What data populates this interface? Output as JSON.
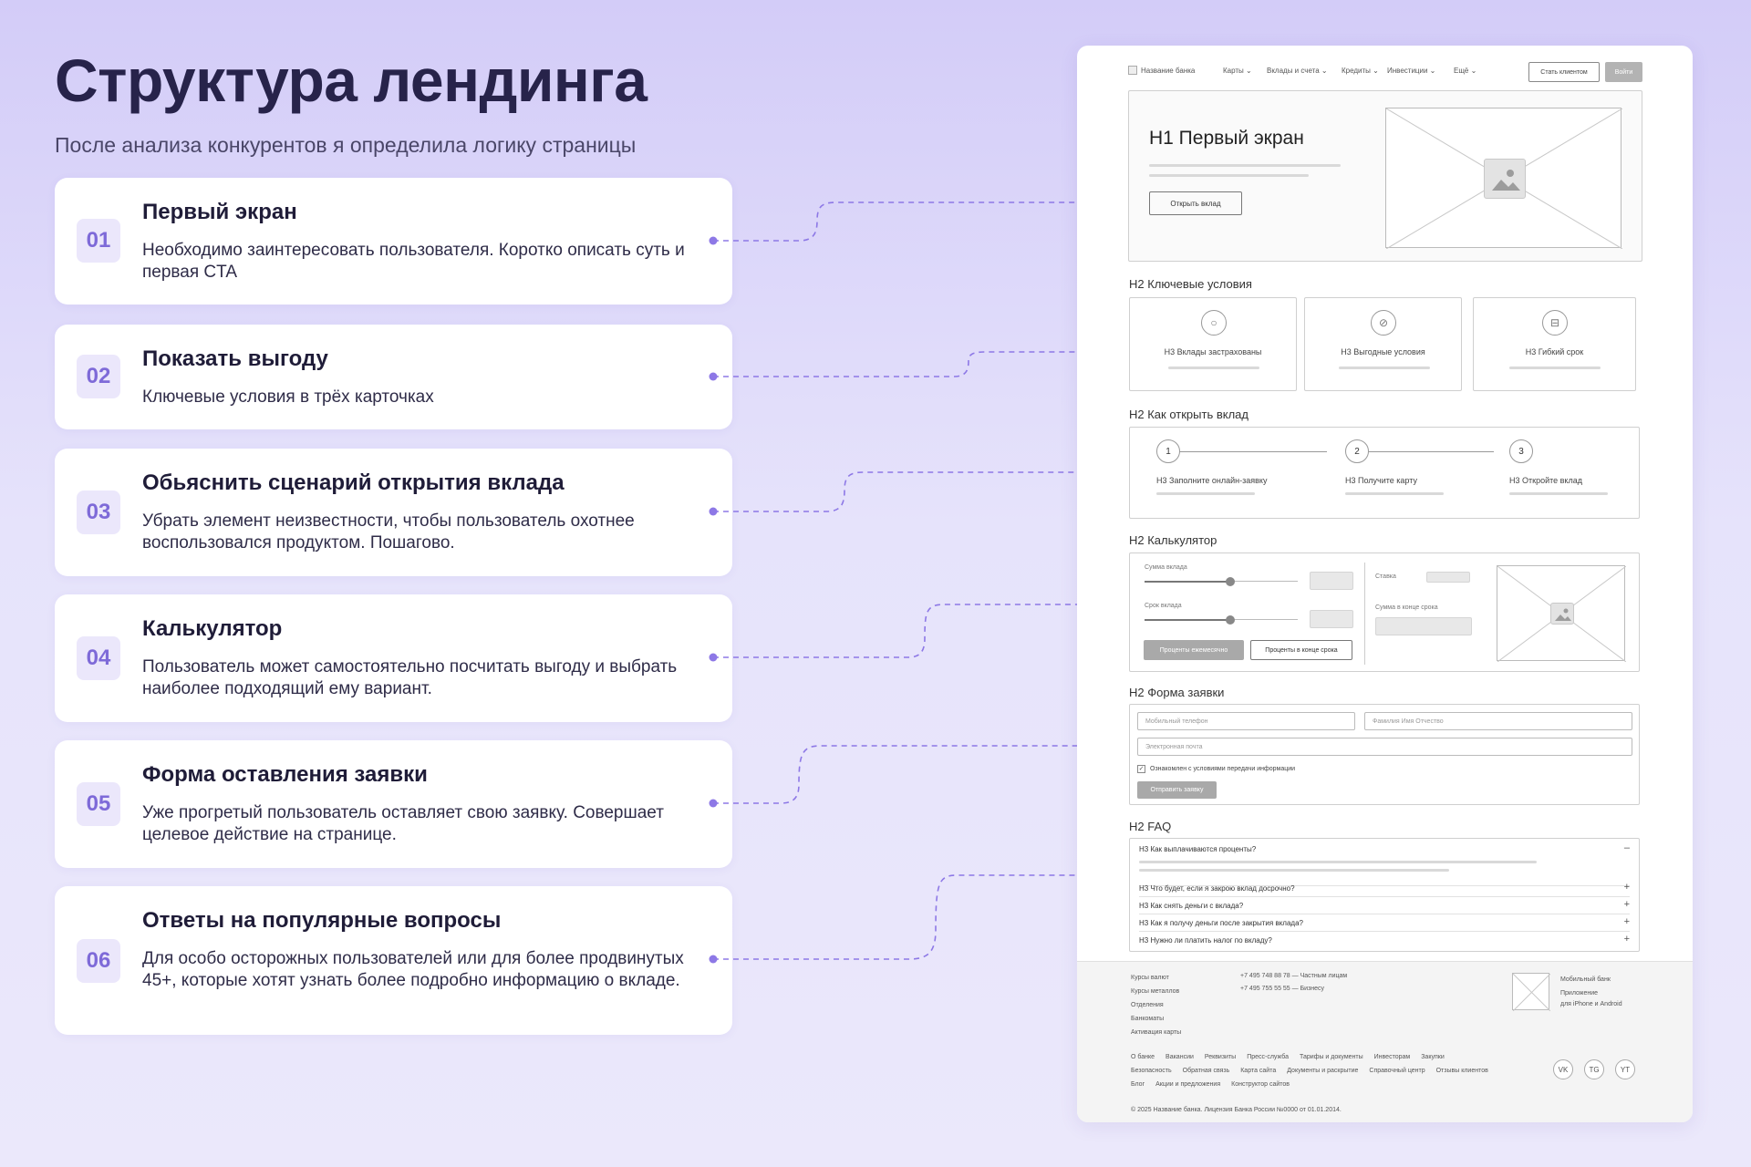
{
  "title": "Структура лендинга",
  "subtitle": "После анализа конкурентов я определила логику страницы",
  "steps": [
    {
      "num": "01",
      "title": "Первый экран",
      "desc": "Необходимо заинтересовать пользователя. Коротко описать суть и первая CTA"
    },
    {
      "num": "02",
      "title": "Показать выгоду",
      "desc": "Ключевые условия в трёх карточках"
    },
    {
      "num": "03",
      "title": "Обьяснить сценарий открытия вклада",
      "desc": "Убрать элемент неизвестности, чтобы пользователь охотнее воспользовался продуктом. Пошагово."
    },
    {
      "num": "04",
      "title": "Калькулятор",
      "desc": "Пользователь может самостоятельно посчитать выгоду и выбрать наиболее подходящий ему вариант."
    },
    {
      "num": "05",
      "title": "Форма оставления заявки",
      "desc": "Уже прогретый пользователь оставляет свою заявку. Совершает целевое действие на странице."
    },
    {
      "num": "06",
      "title": "Ответы на популярные вопросы",
      "desc": "Для особо осторожных пользователей или для более продвинутых 45+, которые хотят узнать более подробно информацию о вкладе."
    }
  ],
  "colors": {
    "accent": "#8d78e6",
    "card_num_bg": "#ebe7fb",
    "num_text": "#7e6ad8"
  },
  "wireframe": {
    "nav": {
      "logo": "Название банка",
      "menu": [
        "Карты ⌄",
        "Вклады и счета ⌄",
        "Кредиты ⌄",
        "Инвестиции ⌄",
        "Ещё ⌄"
      ],
      "client_btn": "Стать клиентом",
      "login_btn": "Войти"
    },
    "hero": {
      "h1": "H1 Первый экран",
      "cta": "Открыть вклад"
    },
    "conditions": {
      "h2": "H2 Ключевые условия",
      "cards": [
        {
          "label": "H3 Вклады застрахованы",
          "icon": "circle-icon"
        },
        {
          "label": "H3 Выгодные условия",
          "icon": "percent-icon"
        },
        {
          "label": "H3 Гибкий срок",
          "icon": "calendar-icon"
        }
      ]
    },
    "how": {
      "h2": "H2 Как открыть вклад",
      "steps": [
        {
          "n": "1",
          "label": "H3 Заполните онлайн-заявку"
        },
        {
          "n": "2",
          "label": "H3 Получите карту"
        },
        {
          "n": "3",
          "label": "H3 Откройте вклад"
        }
      ]
    },
    "calc": {
      "h2": "H2 Калькулятор",
      "sum_label": "Сумма вклада",
      "term_label": "Срок вклада",
      "rate_label": "Ставка",
      "end_label": "Сумма в конце срока",
      "btn_monthly": "Проценты ежемесячно",
      "btn_end": "Проценты в конце срока"
    },
    "form": {
      "h2": "H2 Форма заявки",
      "phone": "Мобильный телефон",
      "fio": "Фамилия Имя Отчество",
      "email": "Электронная почта",
      "consent": "Ознакомлен с условиями передачи информации",
      "submit": "Отправить заявку"
    },
    "faq": {
      "h2": "H2 FAQ",
      "open_q": "H3 Как выплачиваются проценты?",
      "open_sign": "–",
      "items": [
        "H3 Что будет, если я закрою вклад досрочно?",
        "H3 Как снять деньги с вклада?",
        "H3 Как я получу деньги после закрытия вклада?",
        "H3 Нужно ли платить налог по вкладу?"
      ],
      "plus": "+"
    },
    "footer": {
      "col1": [
        "Курсы валют",
        "Курсы металлов",
        "Отделения",
        "Банкоматы",
        "Активация карты"
      ],
      "phone1": "+7 495 748 88 78 — Частным лицам",
      "phone2": "+7 495 755 55 55 — Бизнесу",
      "app_title": "Мобильный банк",
      "app_desc1": "Приложение",
      "app_desc2": "для iPhone и Android",
      "links_row1": [
        "О банке",
        "Вакансии",
        "Реквизиты",
        "Пресс-служба",
        "Тарифы и документы",
        "Инвесторам",
        "Закупки"
      ],
      "links_row2": [
        "Безопасность",
        "Обратная связь",
        "Карта сайта",
        "Документы и раскрытие",
        "Справочный центр",
        "Отзывы клиентов"
      ],
      "links_row3": [
        "Блог",
        "Акции и предложения",
        "Конструктор сайтов"
      ],
      "social": [
        "VK",
        "TG",
        "YT"
      ],
      "copyright": "© 2025 Название банка. Лицензия Банка России №0000 от 01.01.2014."
    }
  }
}
